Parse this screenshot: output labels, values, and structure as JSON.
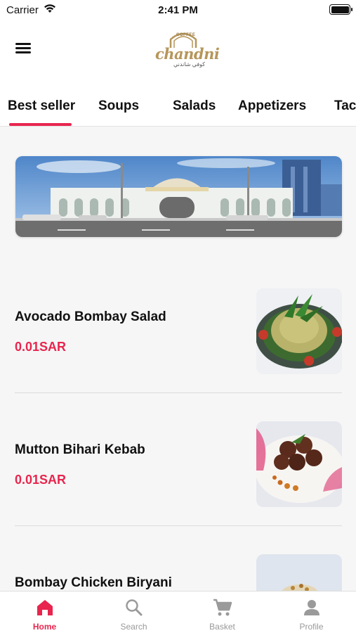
{
  "status_bar": {
    "carrier": "Carrier",
    "time": "2:41 PM"
  },
  "header": {
    "logo": {
      "word": "chandni",
      "tagline": "COFFEE",
      "script": "كوفي شاندني"
    }
  },
  "tabs": [
    {
      "label": "Best seller",
      "active": true
    },
    {
      "label": "Soups",
      "active": false
    },
    {
      "label": "Salads",
      "active": false
    },
    {
      "label": "Appetizers",
      "active": false
    },
    {
      "label": "Tac",
      "active": false
    }
  ],
  "banner": {
    "image": "restaurant-building-photo"
  },
  "items": [
    {
      "name": "Avocado Bombay Salad",
      "price": "0.01SAR",
      "image": "salad-dish-photo"
    },
    {
      "name": "Mutton Bihari Kebab",
      "price": "0.01SAR",
      "image": "kebab-dish-photo"
    },
    {
      "name": "Bombay Chicken Biryani",
      "price": "",
      "image": "biryani-dish-photo"
    }
  ],
  "bottom_nav": [
    {
      "label": "Home",
      "icon": "home-icon",
      "active": true
    },
    {
      "label": "Search",
      "icon": "search-icon",
      "active": false
    },
    {
      "label": "Basket",
      "icon": "cart-icon",
      "active": false
    },
    {
      "label": "Profile",
      "icon": "profile-icon",
      "active": false
    }
  ],
  "colors": {
    "accent": "#e8254e",
    "logo_gold": "#b6965a",
    "inactive": "#999999"
  }
}
